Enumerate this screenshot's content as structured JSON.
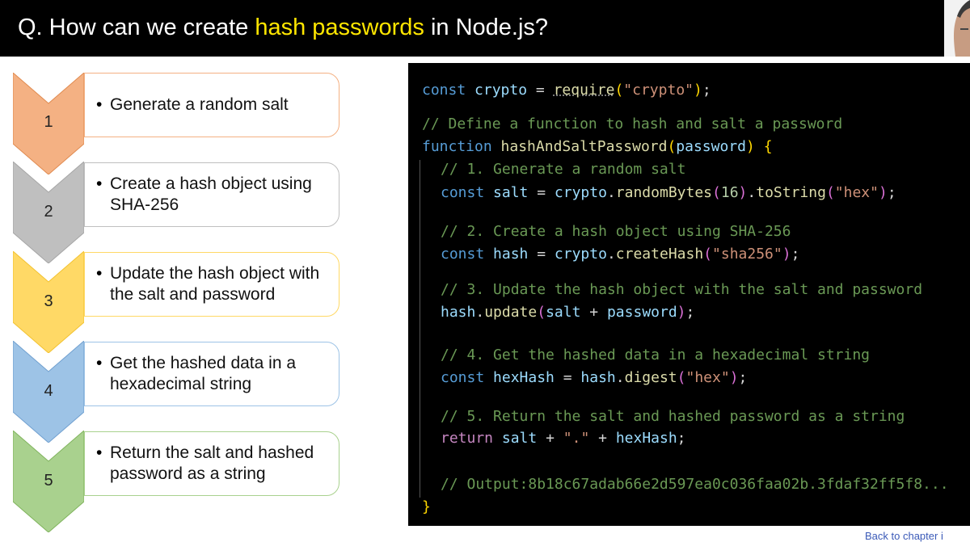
{
  "header": {
    "title_prefix": "Q. How can we create ",
    "title_highlight": "hash passwords",
    "title_suffix": " in Node.js?"
  },
  "steps": [
    {
      "number": "1",
      "text": "Generate a random salt",
      "color": "#f4b183"
    },
    {
      "number": "2",
      "text": "Create a hash object using SHA-256",
      "color": "#bfbfbf"
    },
    {
      "number": "3",
      "text": "Update the hash object with the salt and password",
      "color": "#ffd966"
    },
    {
      "number": "4",
      "text": "Get the hashed data in a hexadecimal string",
      "color": "#9dc3e6"
    },
    {
      "number": "5",
      "text": "Return the salt and hashed password as a string",
      "color": "#a9d18e"
    }
  ],
  "code": {
    "l1": {
      "a": "const",
      "b": "crypto",
      "c": "=",
      "d": "require",
      "e": "(",
      "f": "\"crypto\"",
      "g": ")",
      "h": ";"
    },
    "l2": "// Define a function to hash and salt a password",
    "l3": {
      "a": "function",
      "b": "hashAndSaltPassword",
      "c": "(",
      "d": "password",
      "e": ")",
      "f": "{"
    },
    "l4": "// 1. Generate a random salt",
    "l5": {
      "a": "const",
      "b": "salt",
      "c": "=",
      "d": "crypto",
      "e": ".",
      "f": "randomBytes",
      "g": "(",
      "h": "16",
      "i": ")",
      "j": ".",
      "k": "toString",
      "l": "(",
      "m": "\"hex\"",
      "n": ")",
      "o": ";"
    },
    "l6": "// 2. Create a hash object using SHA-256",
    "l7": {
      "a": "const",
      "b": "hash",
      "c": "=",
      "d": "crypto",
      "e": ".",
      "f": "createHash",
      "g": "(",
      "h": "\"sha256\"",
      "i": ")",
      "j": ";"
    },
    "l8": "// 3. Update the hash object with the salt and password",
    "l9": {
      "a": "hash",
      "b": ".",
      "c": "update",
      "d": "(",
      "e": "salt",
      "f": "+",
      "g": "password",
      "h": ")",
      "i": ";"
    },
    "l10": "// 4. Get the hashed data in a hexadecimal string",
    "l11": {
      "a": "const",
      "b": "hexHash",
      "c": "=",
      "d": "hash",
      "e": ".",
      "f": "digest",
      "g": "(",
      "h": "\"hex\"",
      "i": ")",
      "j": ";"
    },
    "l12": "// 5. Return the salt and hashed password as a string",
    "l13": {
      "a": "return",
      "b": "salt",
      "c": "+",
      "d": "\".\"",
      "e": "+",
      "f": "hexHash",
      "g": ";"
    },
    "l14": "// Output:8b18c67adab66e2d597ea0c036faa02b.3fdaf32ff5f8...",
    "l15": "}"
  },
  "footer": {
    "back_link": "Back to chapter i"
  }
}
